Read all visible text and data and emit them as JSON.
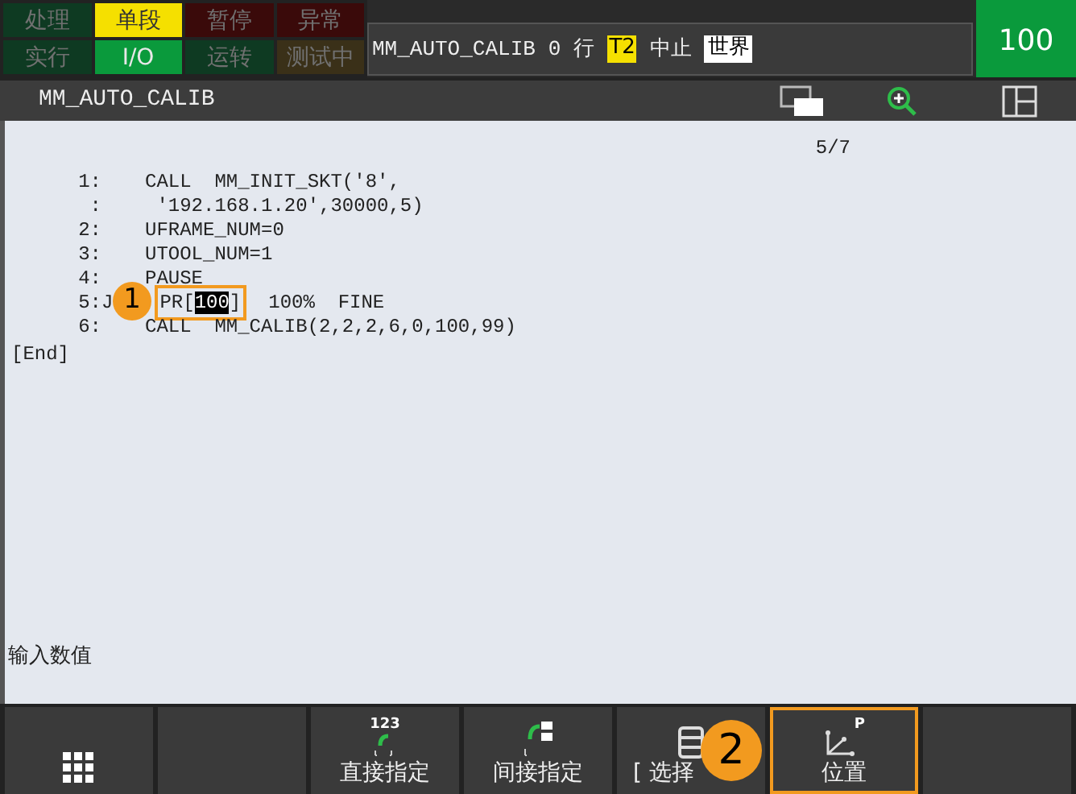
{
  "status_lamps": [
    {
      "label": "处理",
      "color": "#0e3a22",
      "lit": false
    },
    {
      "label": "单段",
      "color": "#f5e000",
      "lit": true
    },
    {
      "label": "暂停",
      "color": "#3a0a0a",
      "lit": false
    },
    {
      "label": "异常",
      "color": "#3a0a0a",
      "lit": false
    },
    {
      "label": "实行",
      "color": "#0e3a22",
      "lit": false
    },
    {
      "label": "I/O",
      "color": "#0a9a3c",
      "lit": true
    },
    {
      "label": "运转",
      "color": "#0e3a22",
      "lit": false
    },
    {
      "label": "测试中",
      "color": "#3a3018",
      "lit": false
    }
  ],
  "status_line": {
    "program": "MM_AUTO_CALIB",
    "line": "0",
    "line_label": "行",
    "mode": "T2",
    "state": "中止",
    "frame": "世界"
  },
  "override": "100",
  "title_bar": {
    "title": "MM_AUTO_CALIB"
  },
  "editor": {
    "page": "5/7",
    "lines": [
      {
        "kind": "plain",
        "num": "1:",
        "text": "CALL  MM_INIT_SKT('8',"
      },
      {
        "kind": "plain",
        "num": ":",
        "text": " '192.168.1.20',30000,5)"
      },
      {
        "kind": "plain",
        "num": "2:",
        "text": "UFRAME_NUM=0"
      },
      {
        "kind": "plain",
        "num": "3:",
        "text": "UTOOL_NUM=1"
      },
      {
        "kind": "plain",
        "num": "4:",
        "text": "PAUSE"
      },
      {
        "kind": "motion",
        "num": "5:",
        "motion": "J",
        "target": "PR[",
        "index": "100",
        "close": "]",
        "rest": "100%  FINE",
        "callout": "1"
      },
      {
        "kind": "plain",
        "num": "6:",
        "text": "CALL  MM_CALIB(2,2,2,6,0,100,99)"
      }
    ],
    "end": "[End]",
    "prompt": "输入数值"
  },
  "function_keys": [
    {
      "kind": "menu",
      "selected": false
    },
    {
      "kind": "empty",
      "selected": false
    },
    {
      "kind": "direct",
      "icon_text": "123",
      "label": "直接指定",
      "selected": false
    },
    {
      "kind": "indirect",
      "label": "间接指定",
      "selected": false
    },
    {
      "kind": "choice",
      "label": "[ 选择",
      "selected": false,
      "callout": "2"
    },
    {
      "kind": "position",
      "icon_text": "P",
      "label": "位置",
      "selected": true
    },
    {
      "kind": "empty",
      "selected": false
    }
  ]
}
